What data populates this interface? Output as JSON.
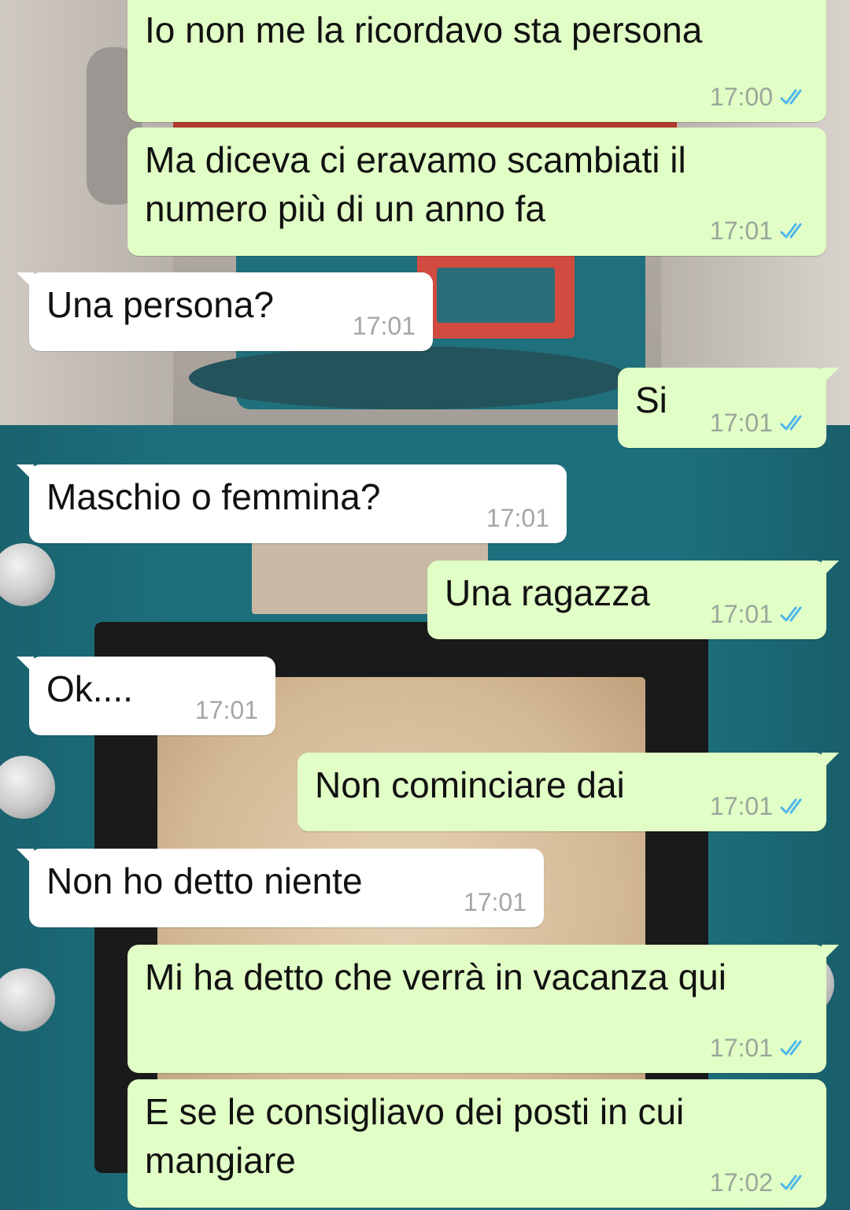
{
  "messages": [
    {
      "direction": "out",
      "text": "Io non me la ricordavo sta persona",
      "time": "17:00",
      "status": "read"
    },
    {
      "direction": "out",
      "text": "Ma diceva ci eravamo scambiati il\nnumero più di un anno fa",
      "time": "17:01",
      "status": "read"
    },
    {
      "direction": "in",
      "text": "Una persona?",
      "time": "17:01"
    },
    {
      "direction": "out",
      "text": "Si",
      "time": "17:01",
      "status": "read"
    },
    {
      "direction": "in",
      "text": "Maschio o femmina?",
      "time": "17:01"
    },
    {
      "direction": "out",
      "text": "Una ragazza",
      "time": "17:01",
      "status": "read"
    },
    {
      "direction": "in",
      "text": "Ok....",
      "time": "17:01"
    },
    {
      "direction": "out",
      "text": "Non cominciare dai",
      "time": "17:01",
      "status": "read"
    },
    {
      "direction": "in",
      "text": "Non ho detto niente",
      "time": "17:01"
    },
    {
      "direction": "out",
      "text": "Mi ha detto che verrà in vacanza qui",
      "time": "17:01",
      "status": "read"
    },
    {
      "direction": "out",
      "text": "E se le consigliavo dei posti in cui\nmangiare",
      "time": "17:02",
      "status": "read"
    }
  ],
  "colors": {
    "outgoing_bubble": "#e1fec6",
    "incoming_bubble": "#ffffff",
    "read_ticks": "#4fb6ec",
    "timestamp": "#9aa79a"
  },
  "icons": {
    "read_receipt": "double-check-icon"
  }
}
